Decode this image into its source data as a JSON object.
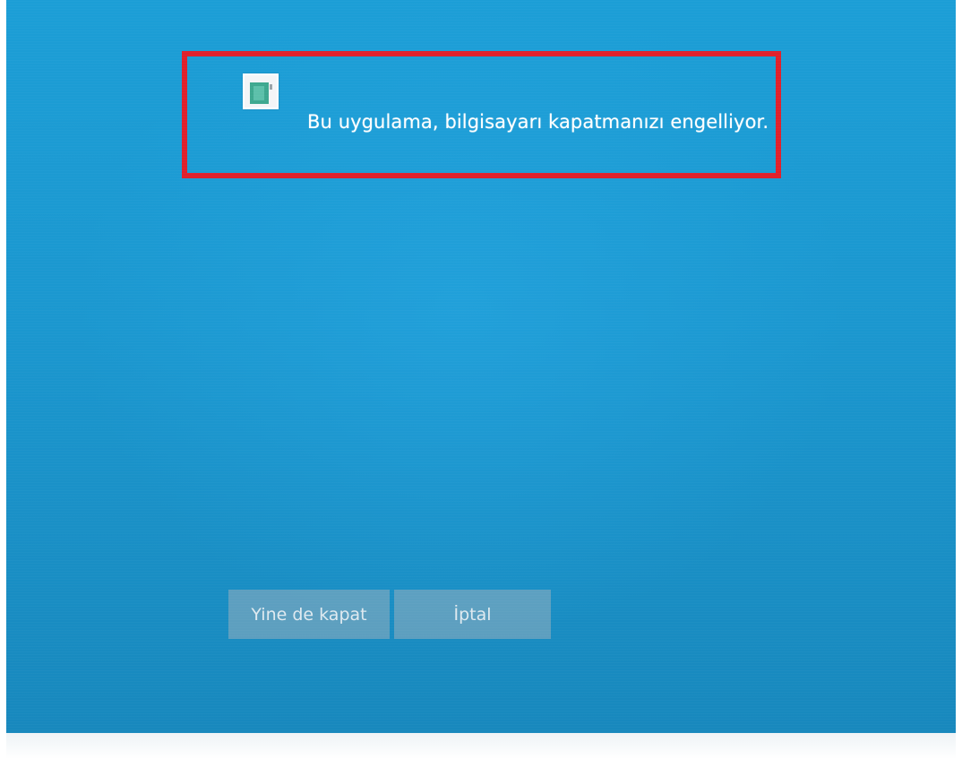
{
  "dialog": {
    "message": "Bu uygulama, bilgisayarı kapatmanızı engelliyor.",
    "app_icon": "app-window-icon"
  },
  "buttons": {
    "shutdown_anyway": "Yine de kapat",
    "cancel": "İptal"
  },
  "colors": {
    "background": "#1b97cf",
    "highlight": "#e0202b",
    "button_bg": "#96afbe",
    "text": "#ffffff"
  }
}
